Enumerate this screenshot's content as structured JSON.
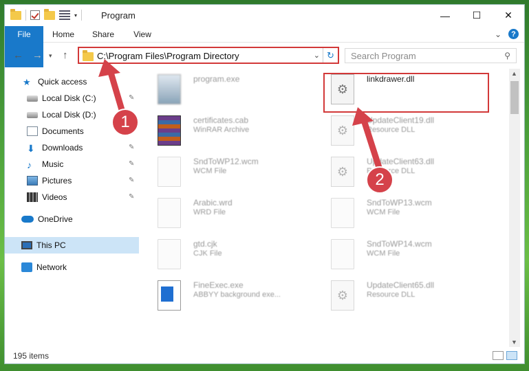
{
  "window": {
    "title": "Program",
    "controls": {
      "minimize": "—",
      "maximize": "☐",
      "close": "✕"
    }
  },
  "ribbon": {
    "tabs": [
      "File",
      "Home",
      "Share",
      "View"
    ],
    "expand": "⌄",
    "help": "?"
  },
  "address": {
    "path": "C:\\Program Files\\Program Directory",
    "search_placeholder": "Search Program"
  },
  "nav": {
    "quick_access": "Quick access",
    "items": [
      {
        "label": "Local Disk (C:)",
        "pinned": true
      },
      {
        "label": "Local Disk (D:)",
        "pinned": false
      },
      {
        "label": "Documents",
        "pinned": true
      },
      {
        "label": "Downloads",
        "pinned": true
      },
      {
        "label": "Music",
        "pinned": true
      },
      {
        "label": "Pictures",
        "pinned": true
      },
      {
        "label": "Videos",
        "pinned": true
      }
    ],
    "onedrive": "OneDrive",
    "this_pc": "This PC",
    "network": "Network"
  },
  "files": [
    {
      "name": "program.exe",
      "type": ""
    },
    {
      "name": "linkdrawer.dll",
      "type": ""
    },
    {
      "name": "certificates.cab",
      "type": "WinRAR Archive"
    },
    {
      "name": "UpdateClient19.dll",
      "type": "Resource DLL"
    },
    {
      "name": "SndToWP12.wcm",
      "type": "WCM File"
    },
    {
      "name": "UpdateClient63.dll",
      "type": "Resource DLL"
    },
    {
      "name": "Arabic.wrd",
      "type": "WRD File"
    },
    {
      "name": "SndToWP13.wcm",
      "type": "WCM File"
    },
    {
      "name": "gtd.cjk",
      "type": "CJK File"
    },
    {
      "name": "SndToWP14.wcm",
      "type": "WCM File"
    },
    {
      "name": "FineExec.exe",
      "type": "ABBYY background exe..."
    },
    {
      "name": "UpdateClient65.dll",
      "type": "Resource DLL"
    }
  ],
  "status": {
    "count": "195 items"
  },
  "annotations": {
    "one": "1",
    "two": "2",
    "color": "#d5424a"
  }
}
